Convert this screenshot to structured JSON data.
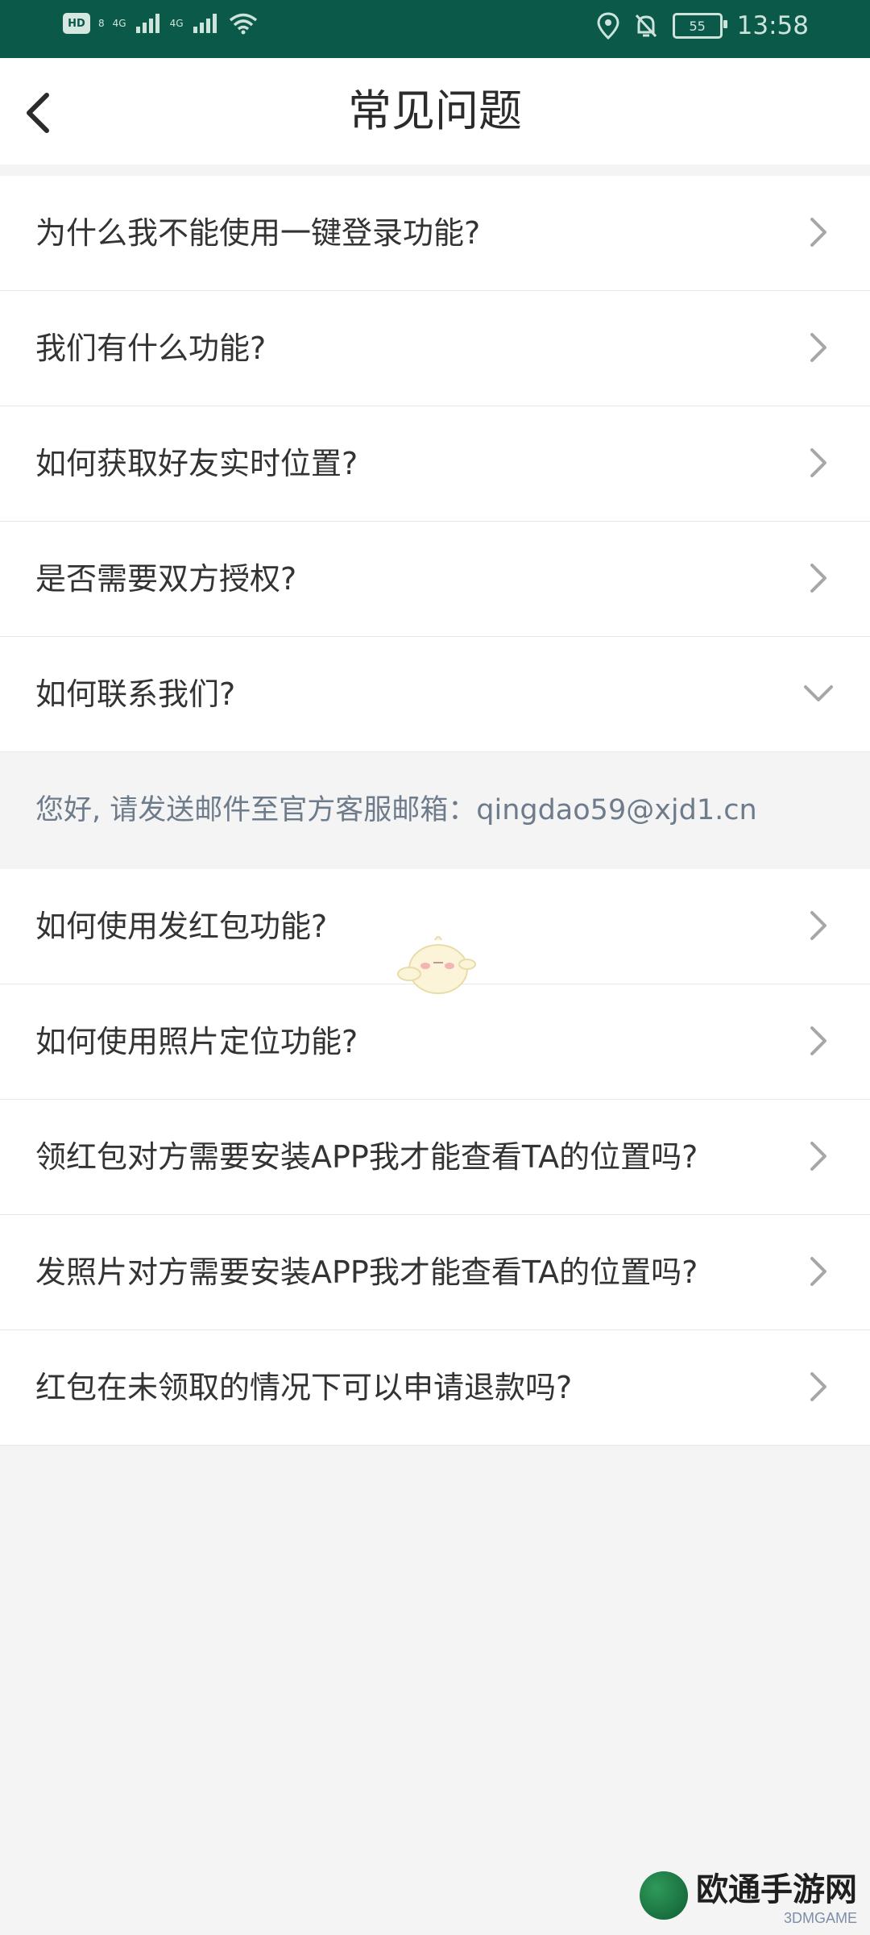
{
  "status_bar": {
    "hd_label": "HD",
    "hd_sub": "8",
    "net1": "4G",
    "net2": "4G",
    "battery_level": "55",
    "time": "13:58"
  },
  "nav": {
    "title": "常见问题"
  },
  "faq": [
    {
      "question": "为什么我不能使用一键登录功能?",
      "expanded": false
    },
    {
      "question": "我们有什么功能?",
      "expanded": false
    },
    {
      "question": "如何获取好友实时位置?",
      "expanded": false
    },
    {
      "question": "是否需要双方授权?",
      "expanded": false
    },
    {
      "question": "如何联系我们?",
      "expanded": true,
      "answer": "您好, 请发送邮件至官方客服邮箱：qingdao59@xjd1.cn"
    },
    {
      "question": "如何使用发红包功能?",
      "expanded": false
    },
    {
      "question": "如何使用照片定位功能?",
      "expanded": false
    },
    {
      "question": "领红包对方需要安装APP我才能查看TA的位置吗?",
      "expanded": false
    },
    {
      "question": "发照片对方需要安装APP我才能查看TA的位置吗?",
      "expanded": false
    },
    {
      "question": "红包在未领取的情况下可以申请退款吗?",
      "expanded": false
    }
  ],
  "watermark": {
    "text": "欧通手游网",
    "sub": "3DMGAME"
  },
  "colors": {
    "status_bar": "#0b5a49",
    "page_bg": "#f4f4f4",
    "answer_text": "#6d7b8a"
  }
}
